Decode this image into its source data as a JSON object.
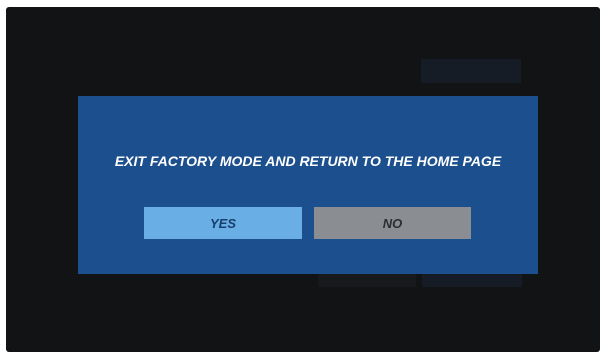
{
  "dialog": {
    "message": "EXIT FACTORY MODE AND RETURN TO THE HOME PAGE",
    "yes_label": "YES",
    "no_label": "NO"
  },
  "colors": {
    "dialog_background": "#1c4f8d",
    "yes_button": "#6aaee6",
    "no_button": "#8a8e93",
    "screen_background": "#121314"
  }
}
